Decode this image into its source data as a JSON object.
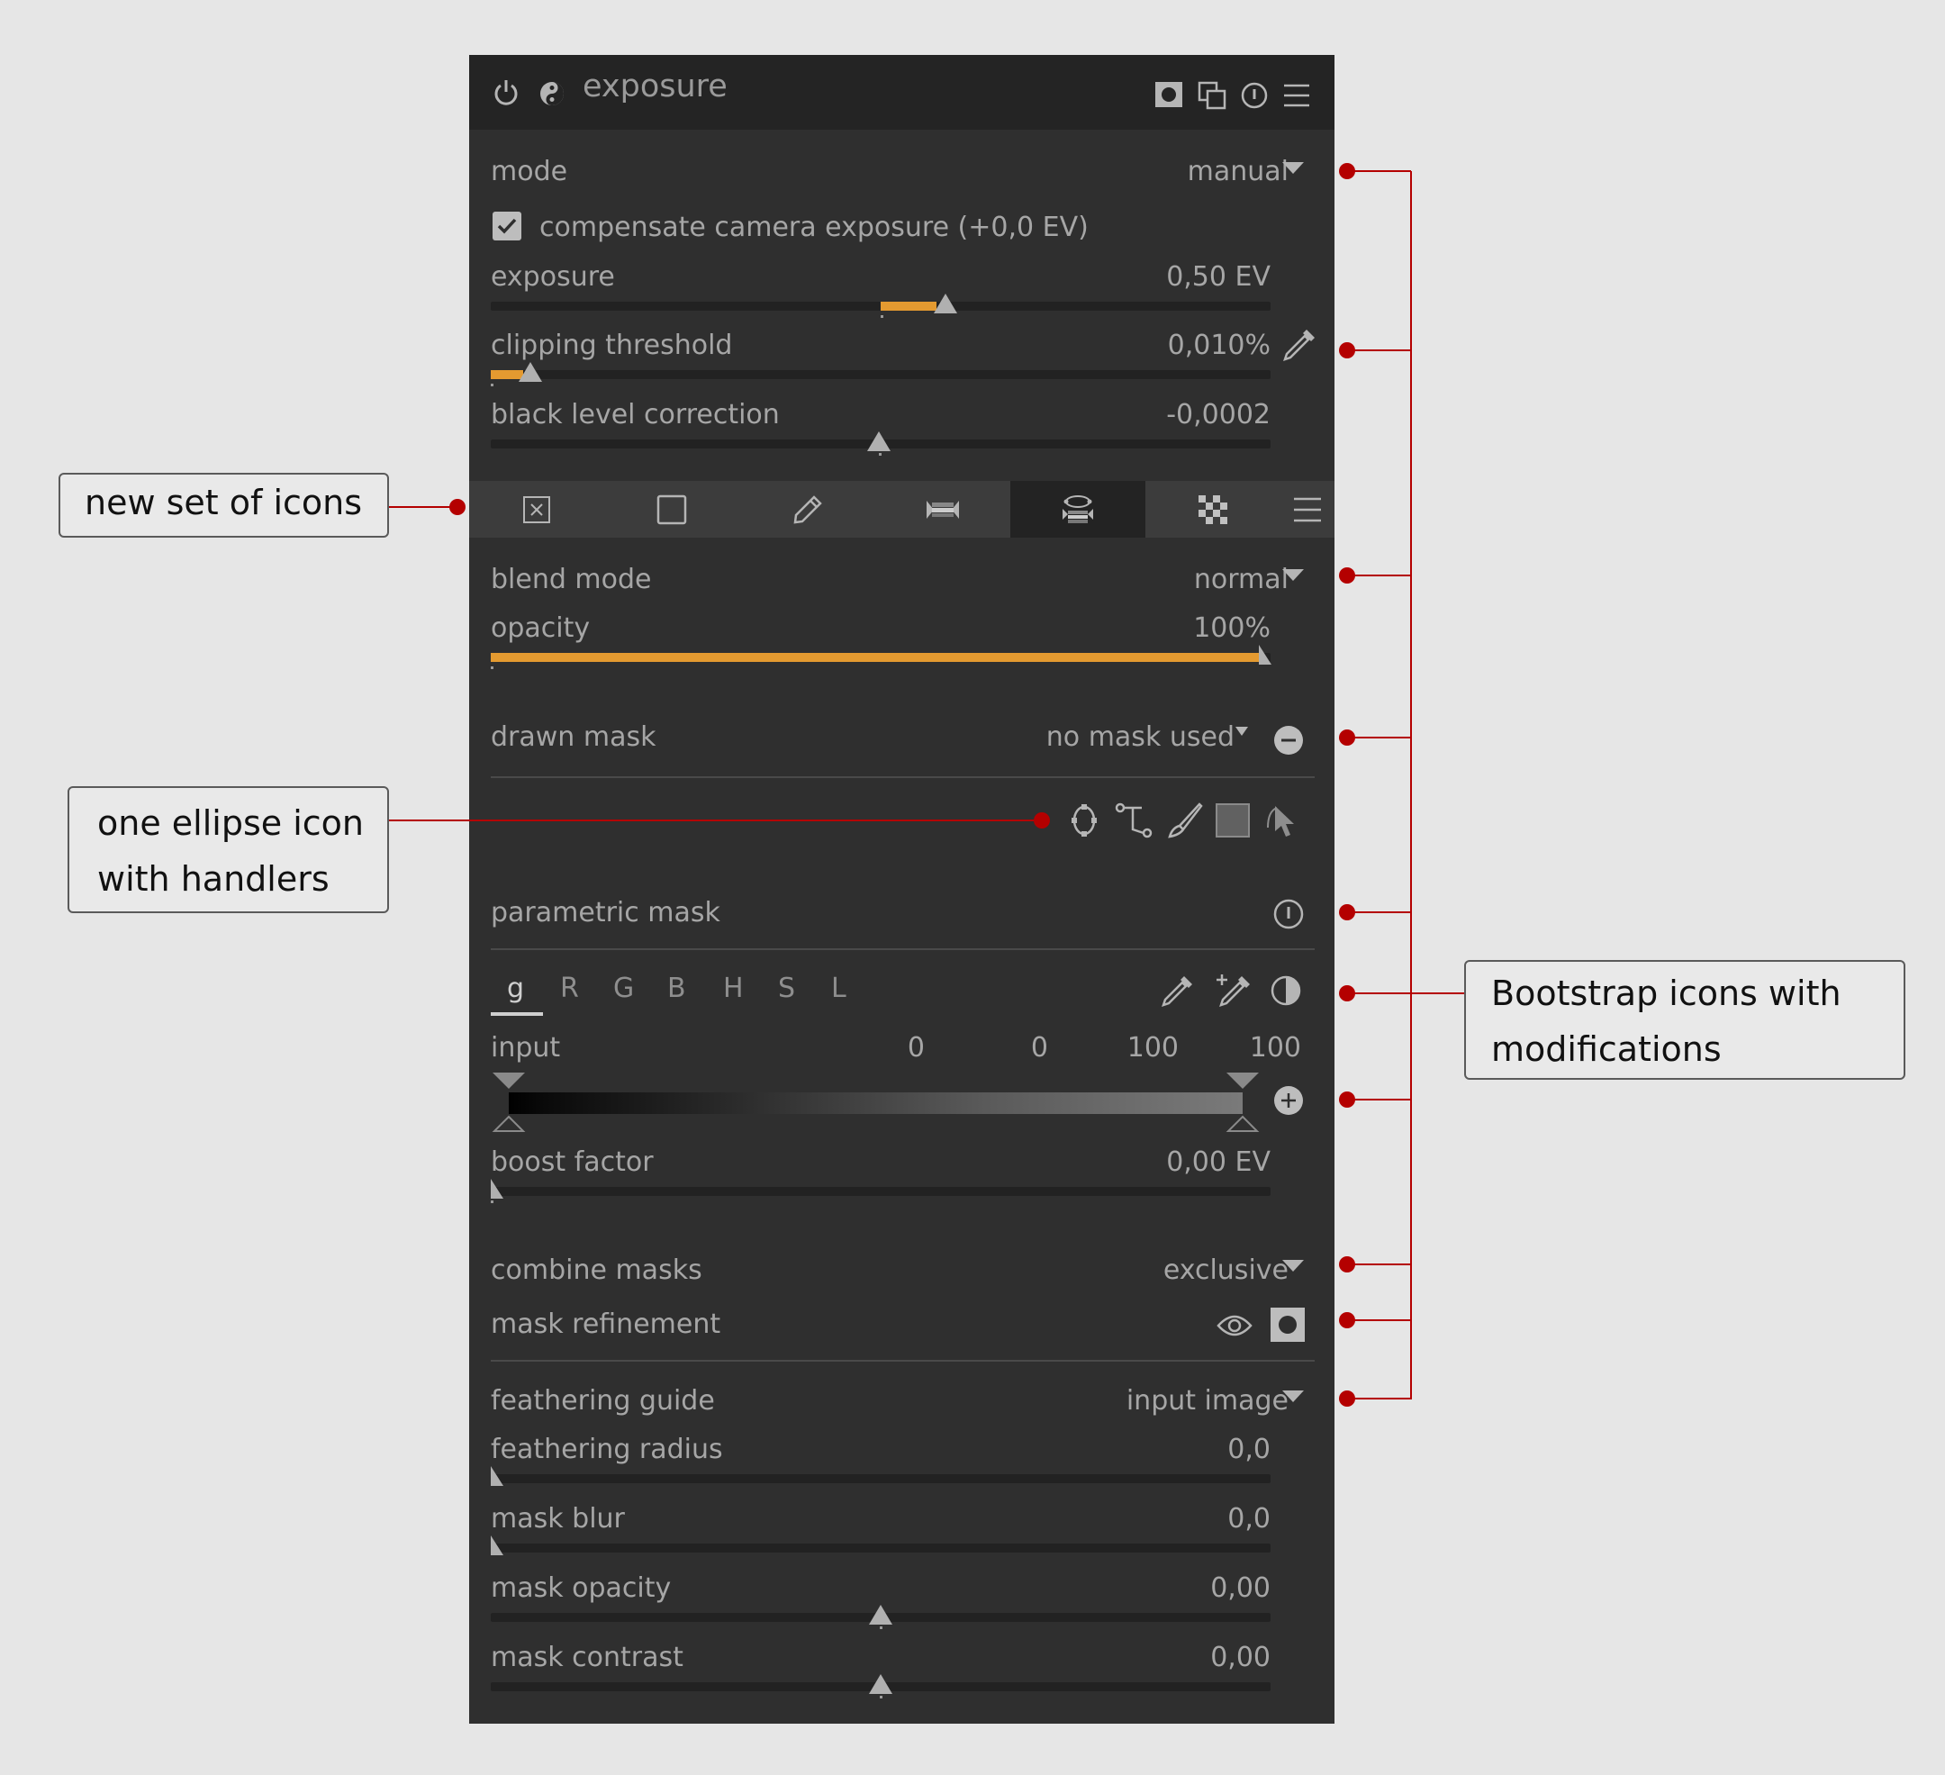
{
  "module": {
    "title": "exposure",
    "icons": [
      "power-icon",
      "yin-yang-icon",
      "mask-indicator-icon",
      "multi-instance-icon",
      "reset-icon",
      "presets-menu-icon"
    ]
  },
  "controls": {
    "mode": {
      "label": "mode",
      "value": "manual"
    },
    "compensate": {
      "label": "compensate camera exposure (+0,0 EV)",
      "checked": true
    },
    "exposure": {
      "label": "exposure",
      "value": "0,50 EV"
    },
    "clipping": {
      "label": "clipping threshold",
      "value": "0,010%"
    },
    "black_level": {
      "label": "black level correction",
      "value": "-0,0002"
    }
  },
  "mask_tabs": {
    "items": [
      "off-icon",
      "uniform-icon",
      "drawn-icon",
      "parametric-icon",
      "drawn-parametric-icon",
      "raster-icon",
      "menu-icon"
    ],
    "active": 4
  },
  "blend": {
    "blend_mode": {
      "label": "blend mode",
      "value": "normal"
    },
    "opacity": {
      "label": "opacity",
      "value": "100%",
      "level": 1.0
    }
  },
  "drawn_mask": {
    "label": "drawn mask",
    "value": "no mask used",
    "shapes": [
      "ellipse-with-handles-icon",
      "path-icon",
      "brush-icon",
      "gradient-icon",
      "edit-shapes-icon"
    ]
  },
  "parametric_mask": {
    "label": "parametric mask",
    "channels": [
      "g",
      "R",
      "G",
      "B",
      "H",
      "S",
      "L"
    ],
    "active_channel": "g",
    "input": {
      "label": "input",
      "values": [
        "0",
        "0",
        "100",
        "100"
      ]
    },
    "boost": {
      "label": "boost factor",
      "value": "0,00 EV"
    }
  },
  "combine": {
    "combine_masks": {
      "label": "combine masks",
      "value": "exclusive"
    },
    "refinement": {
      "label": "mask refinement"
    }
  },
  "feathering": {
    "guide": {
      "label": "feathering guide",
      "value": "input image"
    },
    "radius": {
      "label": "feathering radius",
      "value": "0,0"
    },
    "blur": {
      "label": "mask blur",
      "value": "0,0"
    },
    "opacity": {
      "label": "mask opacity",
      "value": "0,00"
    },
    "contrast": {
      "label": "mask contrast",
      "value": "0,00"
    }
  },
  "callouts": {
    "new_icons": "new set of icons",
    "ellipse_line1": "one ellipse icon",
    "ellipse_line2": "with handlers",
    "bootstrap_line1": "Bootstrap icons with",
    "bootstrap_line2": "modifications"
  },
  "colors": {
    "accent": "#e49a30",
    "annotation": "#b40000",
    "panel": "#2f2f2f"
  }
}
